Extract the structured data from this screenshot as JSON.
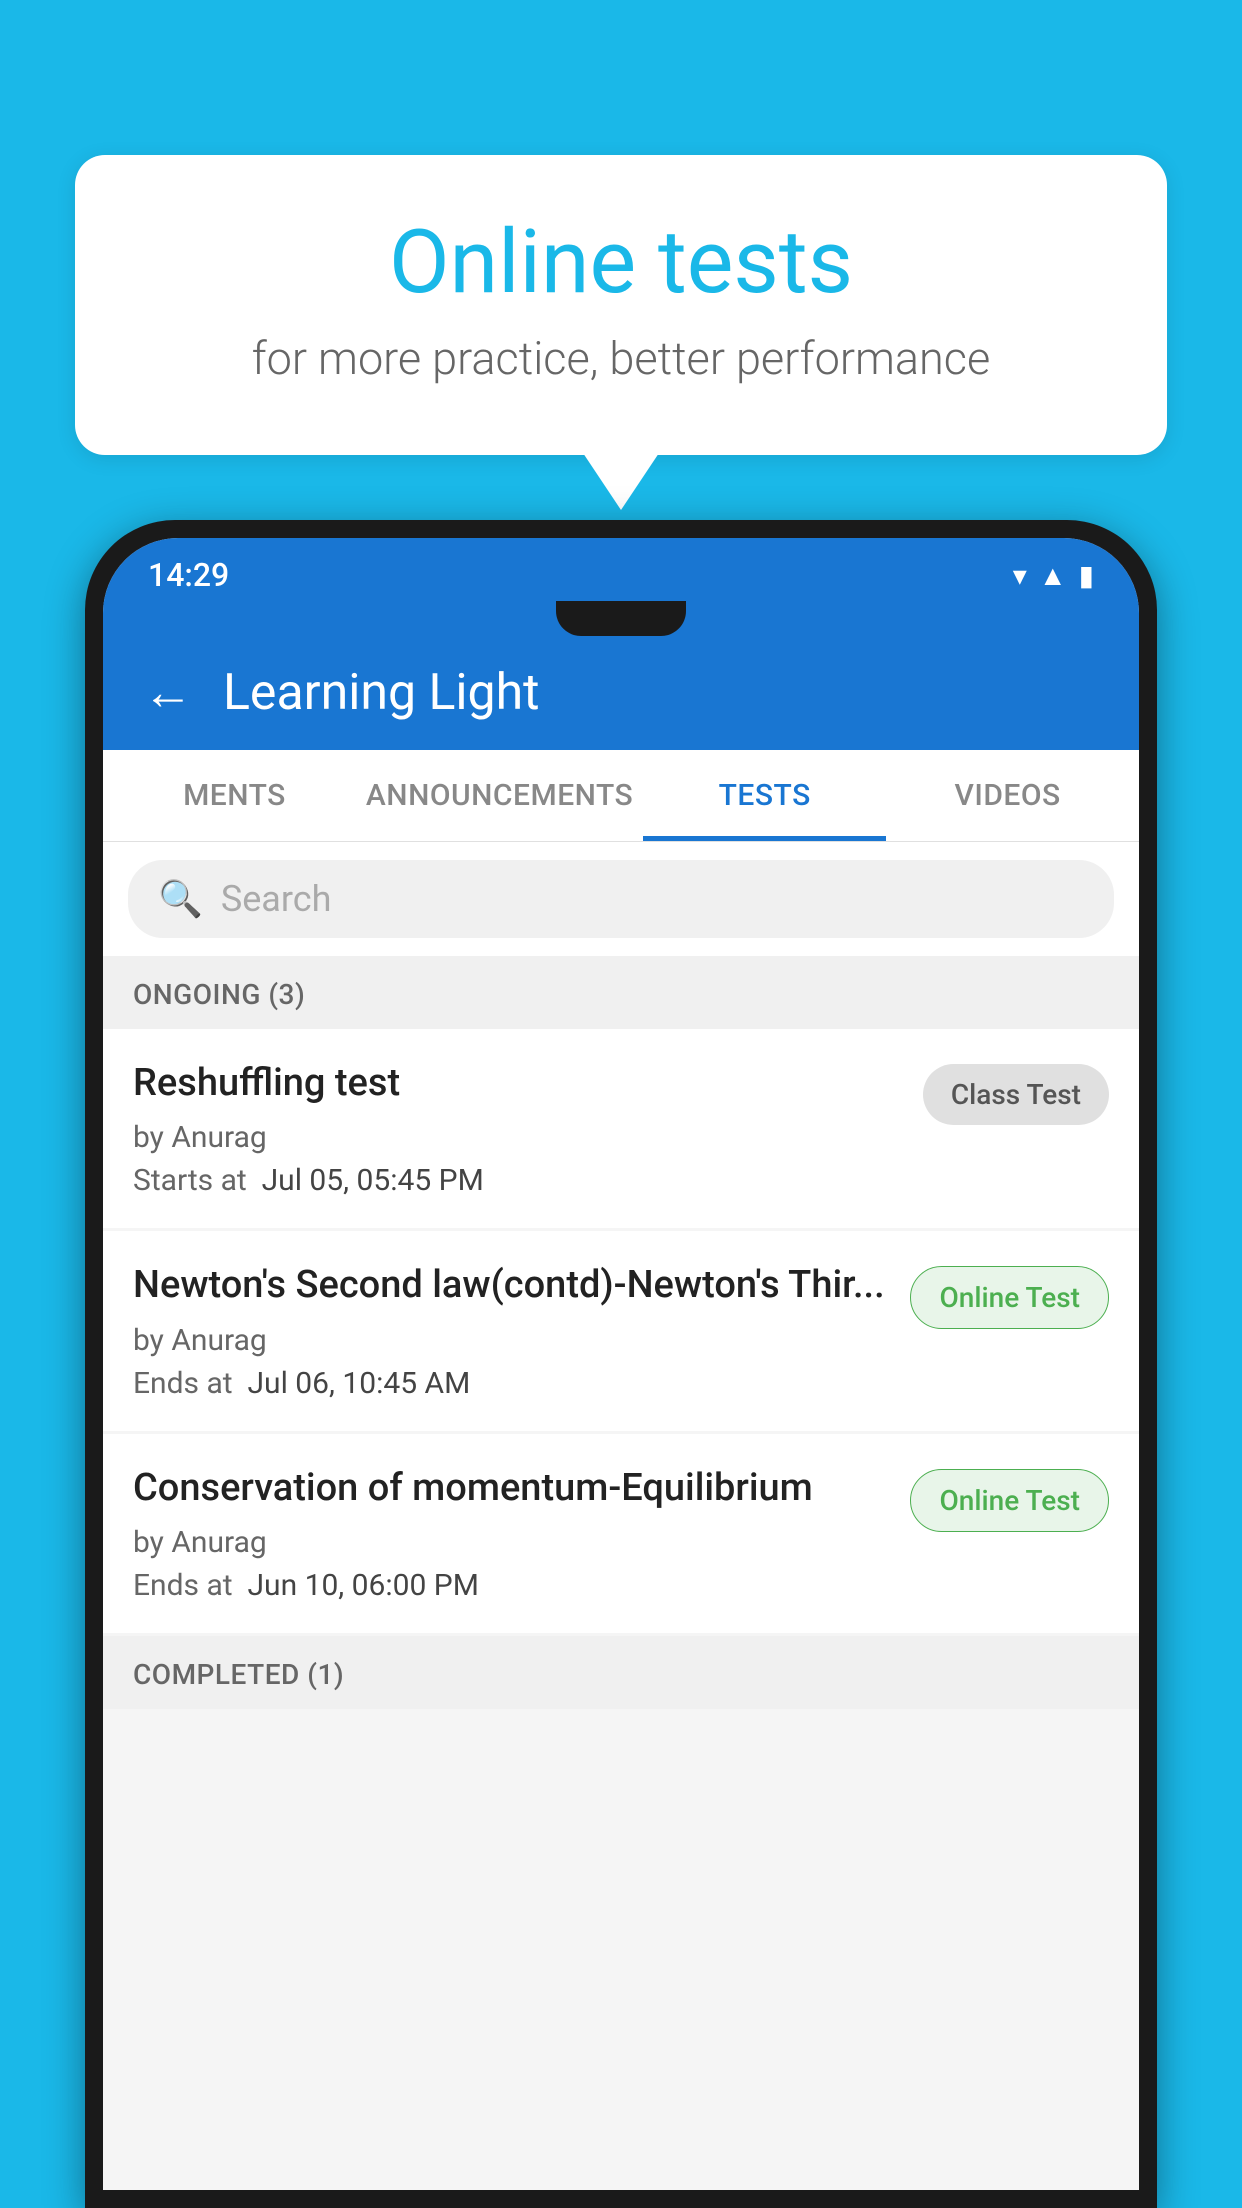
{
  "background_color": "#1ab8e8",
  "speech_bubble": {
    "title": "Online tests",
    "subtitle": "for more practice, better performance"
  },
  "phone": {
    "status_bar": {
      "time": "14:29",
      "icons": [
        "wifi",
        "signal",
        "battery"
      ]
    },
    "header": {
      "back_label": "←",
      "title": "Learning Light"
    },
    "tabs": [
      {
        "label": "MENTS",
        "active": false
      },
      {
        "label": "ANNOUNCEMENTS",
        "active": false
      },
      {
        "label": "TESTS",
        "active": true
      },
      {
        "label": "VIDEOS",
        "active": false
      }
    ],
    "search": {
      "placeholder": "Search"
    },
    "sections": [
      {
        "title": "ONGOING (3)",
        "items": [
          {
            "name": "Reshuffling test",
            "author": "by Anurag",
            "date_label": "Starts at",
            "date_value": "Jul 05, 05:45 PM",
            "badge": "Class Test",
            "badge_type": "class"
          },
          {
            "name": "Newton's Second law(contd)-Newton's Thir...",
            "author": "by Anurag",
            "date_label": "Ends at",
            "date_value": "Jul 06, 10:45 AM",
            "badge": "Online Test",
            "badge_type": "online"
          },
          {
            "name": "Conservation of momentum-Equilibrium",
            "author": "by Anurag",
            "date_label": "Ends at",
            "date_value": "Jun 10, 06:00 PM",
            "badge": "Online Test",
            "badge_type": "online"
          }
        ]
      }
    ],
    "completed_section": {
      "title": "COMPLETED (1)"
    }
  }
}
